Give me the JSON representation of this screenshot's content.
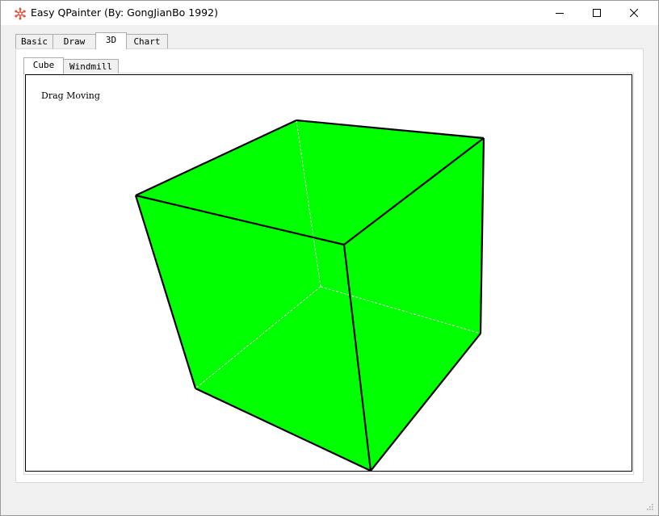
{
  "window": {
    "title": "Easy QPainter (By: GongJianBo 1992)"
  },
  "tabs": [
    {
      "label": "Basic"
    },
    {
      "label": "Draw"
    },
    {
      "label": "3D"
    },
    {
      "label": "Chart"
    }
  ],
  "active_tab": "3D",
  "subtabs": [
    {
      "label": "Cube"
    },
    {
      "label": "Windmill"
    }
  ],
  "active_subtab": "Cube",
  "canvas": {
    "hint": "Drag Moving",
    "cube_fill_color": "#00ff00",
    "edge_color": "#000000",
    "hidden_edge_color": "#ffffff"
  }
}
